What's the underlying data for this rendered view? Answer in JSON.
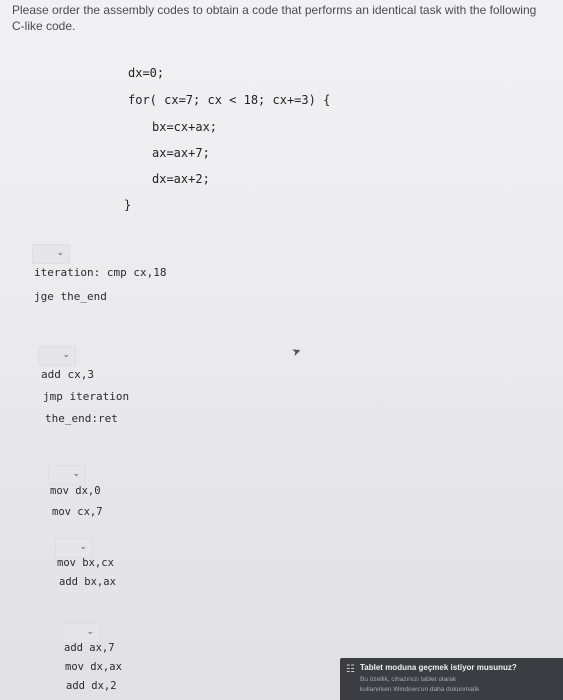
{
  "question": {
    "text": "Please order the assembly codes to obtain a code that performs an identical task with the following C-like code."
  },
  "c_code": {
    "line1": "dx=0;",
    "line2": "for( cx=7; cx < 18; cx+=3) {",
    "line3": "bx=cx+ax;",
    "line4": "ax=ax+7;",
    "line5": "dx=ax+2;",
    "line6": "}"
  },
  "blocks": [
    {
      "selected": "",
      "lines": [
        "iteration: cmp cx,18",
        "jge the_end"
      ]
    },
    {
      "selected": "",
      "lines": [
        "add cx,3",
        "jmp iteration",
        "the_end:ret"
      ]
    },
    {
      "selected": "",
      "lines": [
        "mov dx,0",
        "mov cx,7"
      ]
    },
    {
      "selected": "",
      "lines": [
        "mov bx,cx",
        "add bx,ax"
      ]
    },
    {
      "selected": "",
      "lines": [
        "add ax,7",
        "mov dx,ax",
        "add dx,2"
      ]
    }
  ],
  "toast": {
    "title": "Tablet moduna geçmek istiyor musunuz?",
    "line1": "Bu özellik, cihazınızı tablet olarak",
    "line2": "kullanırken Windows'un daha dokunmatik"
  },
  "icons": {
    "dropdown": "chevron-down-icon",
    "toast": "tablet-mode-icon",
    "pointer": "mouse-cursor-icon"
  }
}
